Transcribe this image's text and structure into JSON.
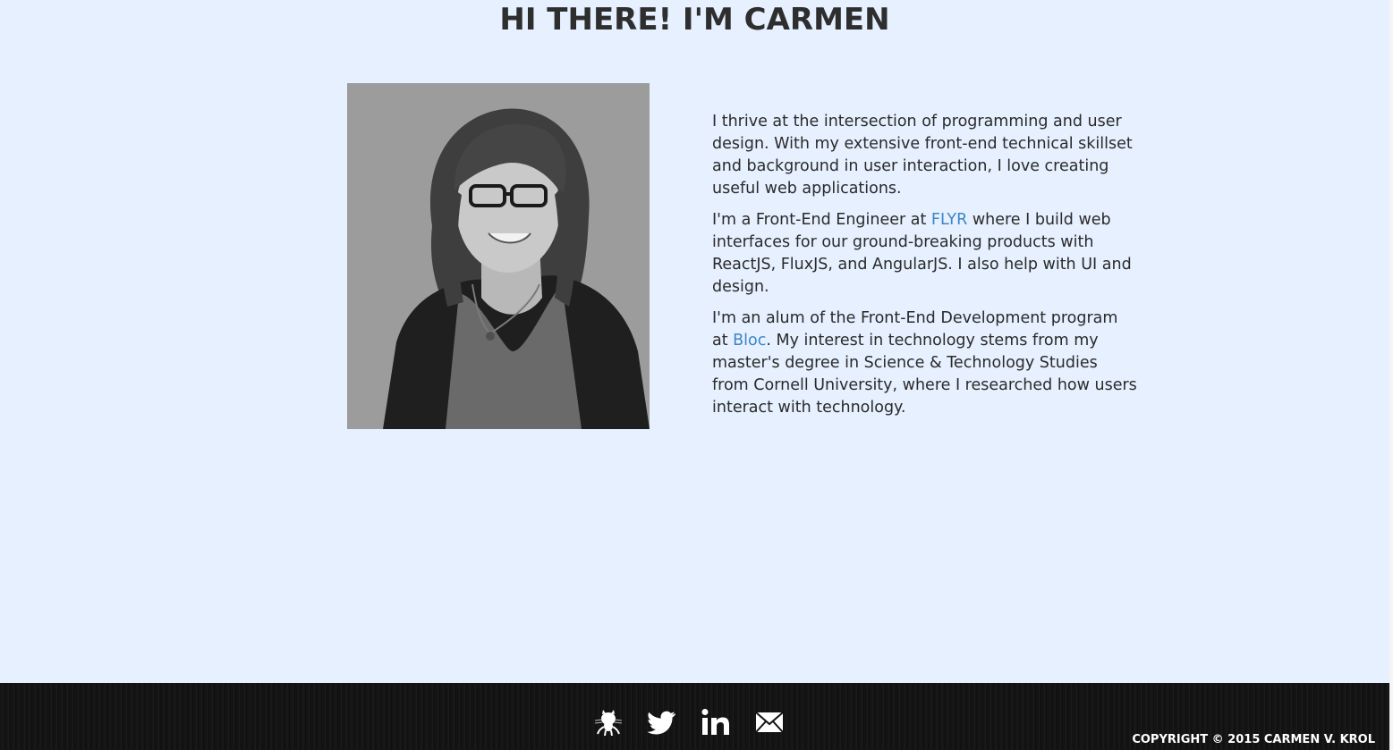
{
  "header": {
    "title": "HI THERE! I'M CARMEN"
  },
  "bio": {
    "p1": "I thrive at the intersection of programming and user design. With my extensive front-end technical skillset and background in user interaction, I love creating useful web applications.",
    "p2_before": "I'm a Front-End Engineer at ",
    "p2_link": "FLYR",
    "p2_after": " where I build web interfaces for our ground-breaking products with ReactJS, FluxJS, and AngularJS. I also help with UI and design.",
    "p3_before": "I'm an alum of the Front-End Development program at ",
    "p3_link": "Bloc",
    "p3_after": ". My interest in technology stems from my master's degree in Science & Technology Studies from Cornell University, where I researched how users interact with technology."
  },
  "footer": {
    "social": [
      {
        "icon": "github-octocat-icon"
      },
      {
        "icon": "twitter-bird-icon"
      },
      {
        "icon": "linkedin-icon"
      },
      {
        "icon": "email-envelope-icon"
      }
    ],
    "copyright": "COPYRIGHT © 2015 CARMEN V. KROL"
  },
  "colors": {
    "background": "#e6f0ff",
    "link": "#3b86c6",
    "footer": "#111111"
  }
}
